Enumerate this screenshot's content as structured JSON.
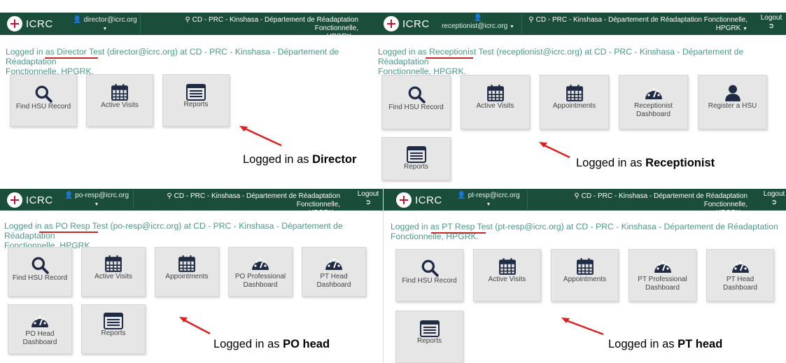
{
  "brand": "ICRC",
  "location_line1": "CD - PRC - Kinshasa - Département de Réadaptation Fonctionnelle,",
  "location_line2": "HPGRK",
  "logout_label": "Logout",
  "logged_prefix": "Logged in as",
  "panels": [
    {
      "user_email": "director@icrc.org",
      "message_line1": "Logged in as Director Test (director@icrc.org) at CD - PRC - Kinshasa - Département de Réadaptation",
      "message_line2": "Fonctionnelle, HPGRK.",
      "tiles": [
        "Find HSU Record",
        "Active Visits",
        "Reports"
      ],
      "role": "Director"
    },
    {
      "user_email": "receptionist@icrc.org",
      "message_line1": "Logged in as Receptionist Test (receptionist@icrc.org) at CD - PRC - Kinshasa - Département de Réadaptation",
      "message_line2": "Fonctionnelle, HPGRK.",
      "tiles": [
        "Find HSU Record",
        "Active Visits",
        "Appointments",
        "Receptionist Dashboard",
        "Register a HSU",
        "Reports"
      ],
      "role": "Receptionist"
    },
    {
      "user_email": "po-resp@icrc.org",
      "message_line1": "Logged in as PO Resp Test (po-resp@icrc.org) at CD - PRC - Kinshasa - Département de Réadaptation",
      "message_line2": "Fonctionnelle, HPGRK.",
      "tiles": [
        "Find HSU Record",
        "Active Visits",
        "Appointments",
        "PO Professional Dashboard",
        "PT Head Dashboard",
        "PO Head Dashboard",
        "Reports"
      ],
      "role": "PO head"
    },
    {
      "user_email": "pt-resp@icrc.org",
      "message_line1": "Logged in as PT Resp Test (pt-resp@icrc.org) at CD - PRC - Kinshasa - Département de Réadaptation",
      "message_line2": "Fonctionnelle, HPGRK.",
      "tiles": [
        "Find HSU Record",
        "Active Visits",
        "Appointments",
        "PT Professional Dashboard",
        "PT Head Dashboard",
        "Reports"
      ],
      "role": "PT head"
    }
  ]
}
